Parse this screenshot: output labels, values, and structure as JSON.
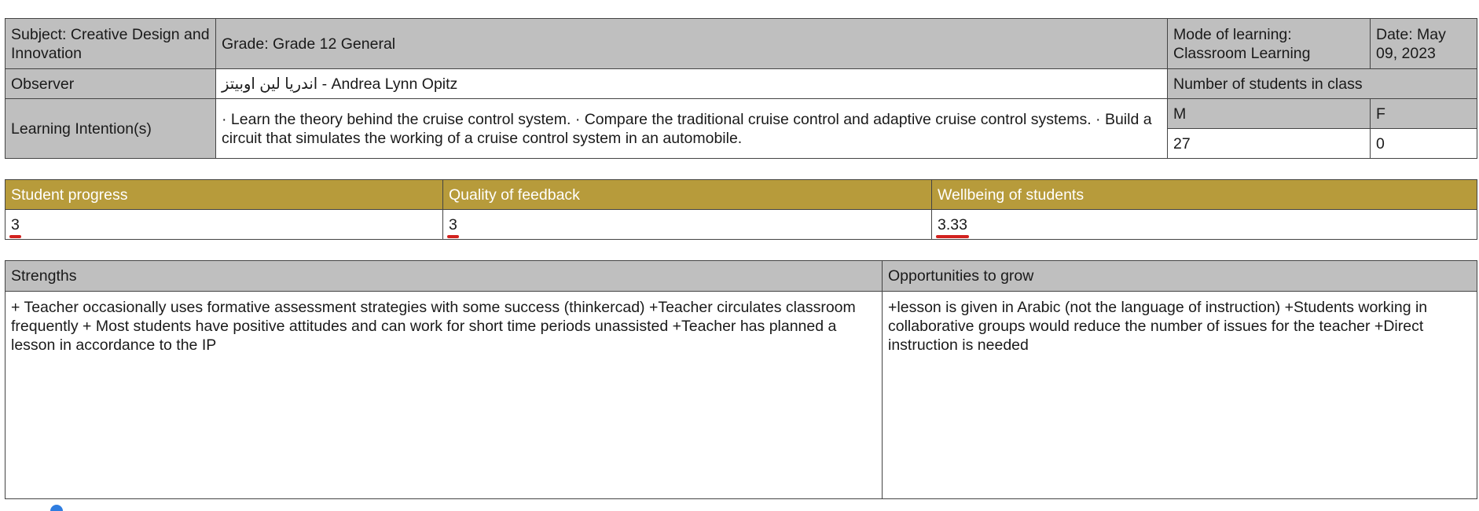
{
  "header": {
    "subject": "Subject: Creative Design and Innovation",
    "grade": "Grade: Grade 12 General",
    "mode": "Mode of learning: Classroom Learning",
    "date": "Date: May 09, 2023",
    "observer_label": "Observer",
    "observer_name_ar": "اندريا لين اوبيتز",
    "observer_name_en": " - Andrea Lynn Opitz",
    "students_label": "Number of students in class",
    "intention_label": "Learning Intention(s)",
    "intention_text": "· Learn the theory behind the cruise control system. · Compare the traditional cruise control and adaptive cruise control systems. · Build a circuit that simulates the working of a cruise control system in an automobile.",
    "male_label": "M",
    "female_label": "F",
    "male_count": "27",
    "female_count": "0"
  },
  "ratings": {
    "headers": [
      "Student progress",
      "Quality of feedback",
      "Wellbeing of students"
    ],
    "values": [
      "3",
      "3",
      "3.33"
    ]
  },
  "feedback": {
    "strengths_label": "Strengths",
    "opportunities_label": "Opportunities to grow",
    "strengths_text": "+ Teacher occasionally uses formative assessment strategies with some success (thinkercad) +Teacher circulates classroom frequently + Most students have positive attitudes and can work for short time periods unassisted +Teacher has planned a lesson in accordance to the IP",
    "opportunities_text": "+lesson is given in Arabic (not the language of instruction) +Students working in collaborative groups would reduce the number of issues for the teacher +Direct instruction is needed"
  },
  "colors": {
    "header_grey": "#bfbfbf",
    "rating_gold": "#b79b3b",
    "underline_red": "#d2221f"
  }
}
